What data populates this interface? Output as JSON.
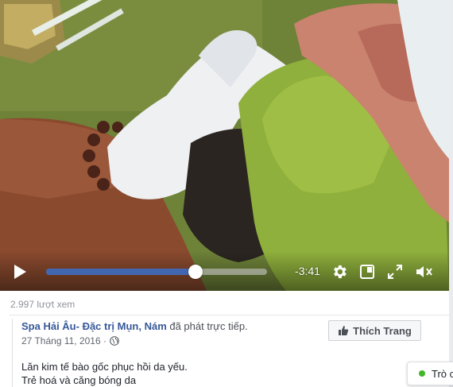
{
  "video": {
    "progress": 0.675,
    "time_remaining": "-3:41",
    "icons": [
      "play-icon",
      "gear-icon",
      "picture-in-picture-icon",
      "expand-icon",
      "muted-speaker-icon"
    ]
  },
  "post": {
    "views": "2.997 lượt xem",
    "author_name": "Spa Hải Âu- Đặc trị Mụn, Nám",
    "author_suffix": " đã phát trực tiếp.",
    "date": "27 Tháng 11, 2016 ·",
    "like_button_label": "Thích Trang",
    "description_line1": "Lăn kim tế bào gốc phục hồi da yếu.",
    "description_line2": "Trẻ hoá và căng bóng da"
  },
  "chat": {
    "label": "Trò c"
  },
  "colors": {
    "progress_fill": "#4267b2",
    "link": "#365899",
    "online": "#42b72a"
  }
}
